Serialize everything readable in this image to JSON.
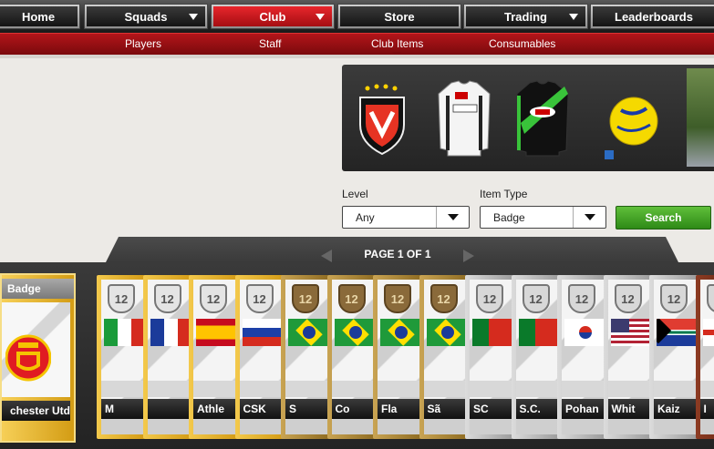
{
  "topnav": {
    "tabs": [
      {
        "label": "Home",
        "dropdown": false,
        "active": false
      },
      {
        "label": "Squads",
        "dropdown": true,
        "active": false
      },
      {
        "label": "Club",
        "dropdown": true,
        "active": true
      },
      {
        "label": "Store",
        "dropdown": false,
        "active": false
      },
      {
        "label": "Trading",
        "dropdown": true,
        "active": false
      },
      {
        "label": "Leaderboards",
        "dropdown": false,
        "active": false
      }
    ]
  },
  "subnav": {
    "items": [
      "Players",
      "Staff",
      "Club Items",
      "Consumables"
    ],
    "active": "Club Items"
  },
  "carousel": {
    "items": [
      "pohang-steelers-badge-icon",
      "white-kit-icon",
      "black-green-kit-icon",
      "yellow-ball-icon",
      "stadium-icon"
    ]
  },
  "filters": {
    "level_label": "Level",
    "level_value": "Any",
    "type_label": "Item Type",
    "type_value": "Badge",
    "search_label": "Search"
  },
  "pager": {
    "text": "PAGE 1 OF 1"
  },
  "selected_card": {
    "header": "Badge",
    "name": "chester Utd"
  },
  "cards": [
    {
      "tier": "gold",
      "rating": "12",
      "flag": "italy",
      "name": "M"
    },
    {
      "tier": "gold",
      "rating": "12",
      "flag": "france",
      "name": ""
    },
    {
      "tier": "gold",
      "rating": "12",
      "flag": "spain",
      "name": "Athle"
    },
    {
      "tier": "gold",
      "rating": "12",
      "flag": "russia",
      "name": "CSK"
    },
    {
      "tier": "bronze",
      "rating": "12",
      "flag": "brazil",
      "name": "S"
    },
    {
      "tier": "bronze",
      "rating": "12",
      "flag": "brazil",
      "name": "Co"
    },
    {
      "tier": "bronze",
      "rating": "12",
      "flag": "brazil",
      "name": "Fla"
    },
    {
      "tier": "bronze",
      "rating": "12",
      "flag": "brazil",
      "name": "Sã"
    },
    {
      "tier": "silver",
      "rating": "12",
      "flag": "portugal",
      "name": "SC"
    },
    {
      "tier": "silver",
      "rating": "12",
      "flag": "portugal",
      "name": "S.C."
    },
    {
      "tier": "silver",
      "rating": "12",
      "flag": "korea",
      "name": "Pohan"
    },
    {
      "tier": "silver",
      "rating": "12",
      "flag": "usa",
      "name": "Whit"
    },
    {
      "tier": "silver",
      "rating": "12",
      "flag": "south-africa",
      "name": "Kaiz"
    },
    {
      "tier": "red",
      "rating": "12",
      "flag": "england",
      "name": "I"
    }
  ]
}
